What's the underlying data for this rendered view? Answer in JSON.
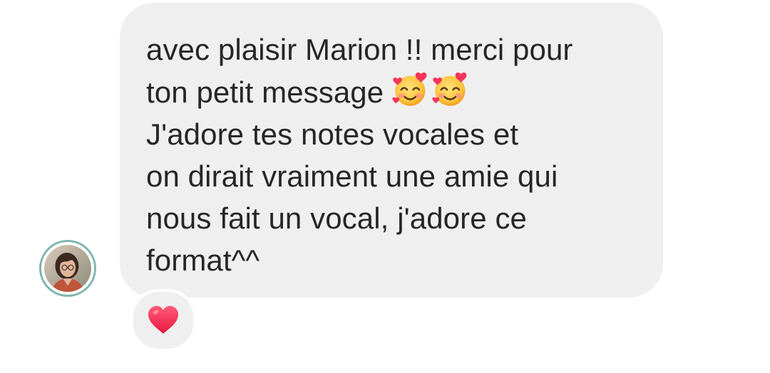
{
  "message": {
    "lines": [
      "avec plaisir Marion !! merci pour",
      "ton petit message ",
      "J'adore tes notes vocales et",
      "on dirait vraiment une amie qui",
      "nous fait un vocal, j'adore ce",
      "format^^"
    ],
    "inline_emojis": [
      "smiling-face-with-hearts",
      "smiling-face-with-hearts"
    ]
  },
  "reaction": {
    "emoji": "red-heart"
  },
  "avatar": {
    "ring_color": "#7fb5b0"
  },
  "colors": {
    "bubble_bg": "#efefef",
    "text": "#262626",
    "heart": "#f6345a"
  }
}
